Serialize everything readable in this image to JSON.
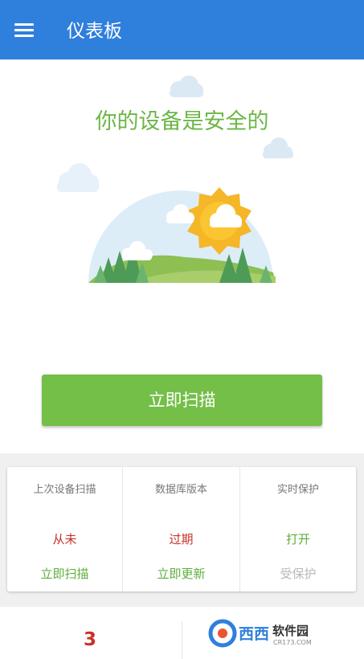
{
  "appbar": {
    "menu_icon": "hamburger-menu-icon",
    "title": "仪表板",
    "color": "#2f7fdc"
  },
  "hero": {
    "status_title": "你的设备是安全的",
    "illustration": "sun-cloud-hills-illustration",
    "scan_button": "立即扫描",
    "accent": "#74bf47"
  },
  "status": {
    "columns": [
      {
        "label": "上次设备扫描",
        "value": "从未",
        "value_color": "#c8312a",
        "action": "立即扫描",
        "action_enabled": true
      },
      {
        "label": "数据库版本",
        "value": "过期",
        "value_color": "#c8312a",
        "action": "立即更新",
        "action_enabled": true
      },
      {
        "label": "实时保护",
        "value": "打开",
        "value_color": "#5fae3b",
        "action": "受保护",
        "action_enabled": false
      }
    ]
  },
  "bottom": {
    "count": "3"
  },
  "watermark": {
    "brand": "西西",
    "site_name": "软件园",
    "site": "CR173.COM"
  }
}
